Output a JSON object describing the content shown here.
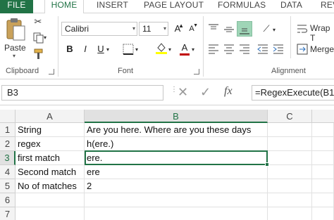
{
  "ribbon_tabs": [
    "FILE",
    "HOME",
    "INSERT",
    "PAGE LAYOUT",
    "FORMULAS",
    "DATA",
    "REV"
  ],
  "clipboard": {
    "paste_label": "Paste",
    "group_label": "Clipboard"
  },
  "font": {
    "name": "Calibri",
    "size": "11",
    "grow": "A",
    "shrink": "A",
    "bold": "B",
    "italic": "I",
    "underline": "U",
    "color_letter": "A",
    "group_label": "Font",
    "font_color": "#c00000",
    "highlight_color": "#ffff00"
  },
  "alignment": {
    "wrap_label": "Wrap T",
    "merge_label": "Merge",
    "group_label": "Alignment"
  },
  "formula_bar": {
    "name_box": "B3",
    "fx": "fx",
    "formula": "=RegexExecute(B1"
  },
  "columns": [
    "A",
    "B",
    "C"
  ],
  "rows": [
    {
      "num": "1",
      "a": "String",
      "b": "Are you here. Where are you these days",
      "c": ""
    },
    {
      "num": "2",
      "a": "regex",
      "b": "h(ere.)",
      "c": ""
    },
    {
      "num": "3",
      "a": "first match",
      "b": "ere.",
      "c": ""
    },
    {
      "num": "4",
      "a": "Second match",
      "b": "ere",
      "c": ""
    },
    {
      "num": "5",
      "a": "No of matches",
      "b": "2",
      "c": ""
    },
    {
      "num": "6",
      "a": "",
      "b": "",
      "c": ""
    },
    {
      "num": "7",
      "a": "",
      "b": "",
      "c": ""
    }
  ],
  "colors": {
    "accent": "#217346"
  }
}
